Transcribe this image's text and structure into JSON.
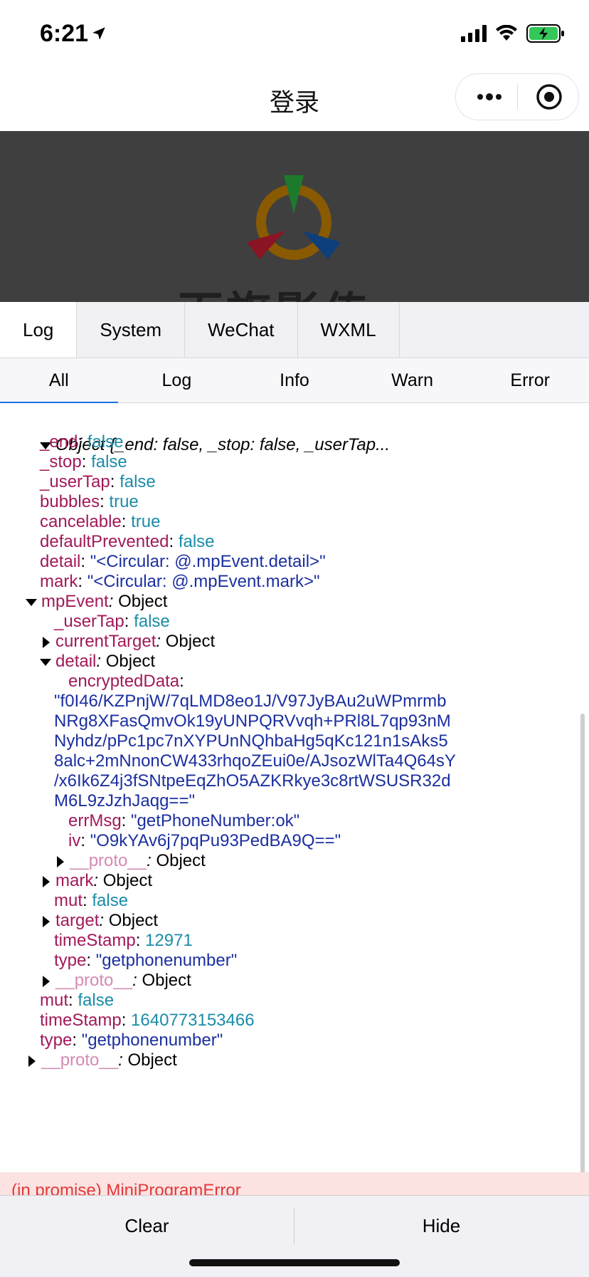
{
  "status": {
    "time": "6:21"
  },
  "nav": {
    "title": "登录"
  },
  "tabs": [
    "Log",
    "System",
    "WeChat",
    "WXML"
  ],
  "subtabs": [
    "All",
    "Log",
    "Info",
    "Warn",
    "Error"
  ],
  "log": {
    "root": "Object {_end: false, _stop: false, _userTap...",
    "end": {
      "k": "_end",
      "v": "false"
    },
    "stop": {
      "k": "_stop",
      "v": "false"
    },
    "userTap": {
      "k": "_userTap",
      "v": "false"
    },
    "bubbles": {
      "k": "bubbles",
      "v": "true"
    },
    "cancelable": {
      "k": "cancelable",
      "v": "true"
    },
    "defaultPrevented": {
      "k": "defaultPrevented",
      "v": "false"
    },
    "detail": {
      "k": "detail",
      "v": "\"<Circular: @.mpEvent.detail>\""
    },
    "mark": {
      "k": "mark",
      "v": "\"<Circular: @.mpEvent.mark>\""
    },
    "mpEvent": {
      "k": "mpEvent",
      "v": "Object"
    },
    "mp_userTap": {
      "k": "_userTap",
      "v": "false"
    },
    "currentTarget": {
      "k": "currentTarget",
      "v": "Object"
    },
    "mp_detail": {
      "k": "detail",
      "v": "Object"
    },
    "encryptedData": {
      "k": "encryptedData"
    },
    "enc_lines": [
      "\"f0I46/KZPnjW/7qLMD8eo1J/V97JyBAu2uWPmrmb",
      "NRg8XFasQmvOk19yUNPQRVvqh+PRl8L7qp93nM",
      "Nyhdz/pPc1pc7nXYPUnNQhbaHg5qKc121n1sAks5",
      "8alc+2mNnonCW433rhqoZEui0e/AJsozWlTa4Q64sY",
      "/x6Ik6Z4j3fSNtpeEqZhO5AZKRkye3c8rtWSUSR32d",
      "M6L9zJzhJaqg==\""
    ],
    "errMsg": {
      "k": "errMsg",
      "v": "\"getPhoneNumber:ok\""
    },
    "iv": {
      "k": "iv",
      "v": "\"O9kYAv6j7pqPu93PedBA9Q==\""
    },
    "detail_proto": {
      "k": "__proto__",
      "v": "Object"
    },
    "mp_mark": {
      "k": "mark",
      "v": "Object"
    },
    "mp_mut": {
      "k": "mut",
      "v": "false"
    },
    "mp_target": {
      "k": "target",
      "v": "Object"
    },
    "mp_timeStamp": {
      "k": "timeStamp",
      "v": "12971"
    },
    "mp_type": {
      "k": "type",
      "v": "\"getphonenumber\""
    },
    "mp_proto": {
      "k": "__proto__",
      "v": "Object"
    },
    "mut": {
      "k": "mut",
      "v": "false"
    },
    "timeStamp": {
      "k": "timeStamp",
      "v": "1640773153466"
    },
    "type": {
      "k": "type",
      "v": "\"getphonenumber\""
    },
    "proto": {
      "k": "__proto__",
      "v": "Object"
    }
  },
  "error_preview": "(in promise) MiniProgramError",
  "buttons": {
    "clear": "Clear",
    "hide": "Hide"
  },
  "brand": {
    "text": "百旗影传"
  },
  "colors": {
    "key": "#a1195a",
    "boolean": "#1a8ca8",
    "string": "#1b2fa0",
    "error_bg": "#fde2e2",
    "overlay": "#3f3f3f"
  }
}
